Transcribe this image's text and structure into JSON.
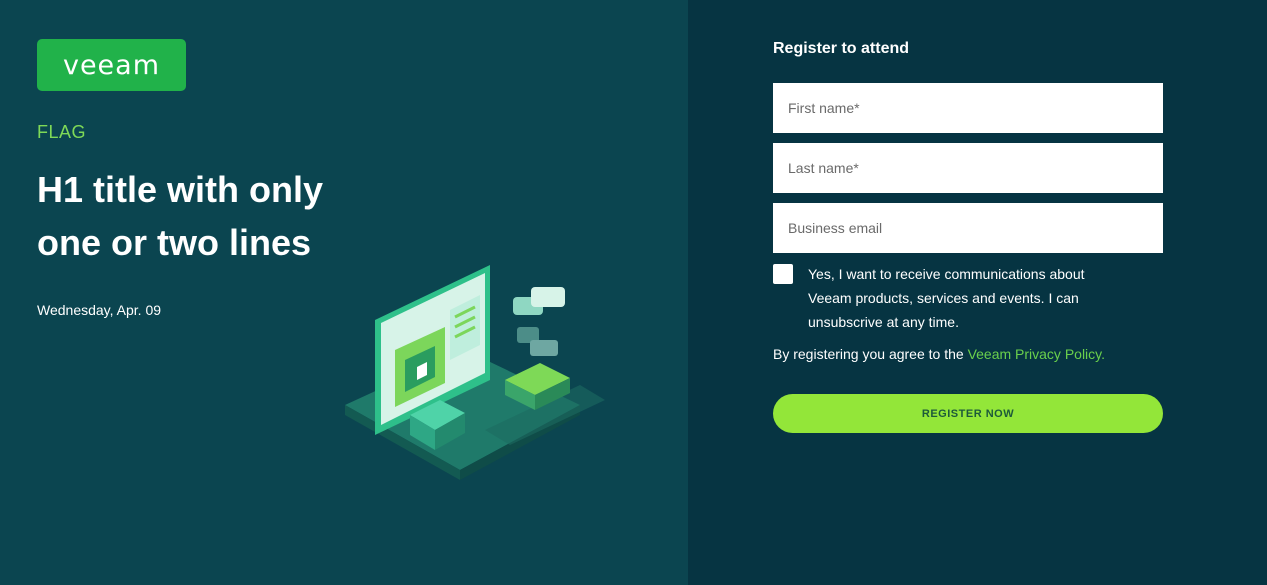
{
  "logo": {
    "text": "VEEAM"
  },
  "hero": {
    "flag": "FLAG",
    "title": "H1 title with only one or two lines",
    "date": "Wednesday, Apr. 09"
  },
  "form": {
    "title": "Register to attend",
    "first_name_placeholder": "First name*",
    "last_name_placeholder": "Last name*",
    "email_placeholder": "Business email",
    "consent_text": "Yes, I want to receive communications about Veeam products, services and events. I can unsubscrive at any time.",
    "agree_prefix": "By registering you agree to the ",
    "policy_link": "Veeam Privacy Policy.",
    "submit_label": "REGISTER NOW"
  },
  "colors": {
    "left_bg": "#0b4550",
    "right_bg": "#063442",
    "brand_green": "#21b24a",
    "flag_green": "#7ed957",
    "button_green": "#93e639"
  },
  "icons": {
    "illustration": "isometric-computer-illustration"
  }
}
